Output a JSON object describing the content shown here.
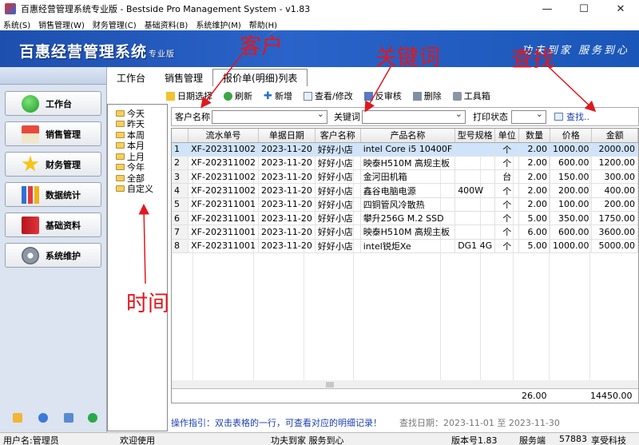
{
  "window": {
    "title": "百惠经营管理系统专业版 - Bestside Pro Management System - v1.83",
    "controls": [
      "—",
      "☐",
      "✕"
    ]
  },
  "menu": [
    "系统(S)",
    "销售管理(W)",
    "财务管理(C)",
    "基础资料(B)",
    "系统维护(M)",
    "帮助(H)"
  ],
  "banner": {
    "brand": "百惠经营管理系统",
    "edition": "专业版",
    "slogan": "功夫到家  服务到心"
  },
  "nav": [
    "工作台",
    "销售管理",
    "财务管理",
    "数据统计",
    "基础资料",
    "系统维护"
  ],
  "tabs": [
    "工作台",
    "销售管理",
    "报价单(明细)列表"
  ],
  "toolbar": [
    "日期选择",
    "刷新",
    "新增",
    "查看/修改",
    "反审核",
    "删除",
    "工具箱"
  ],
  "tree": [
    "今天",
    "昨天",
    "本周",
    "本月",
    "上月",
    "今年",
    "全部",
    "自定义"
  ],
  "search": {
    "customer_label": "客户名称",
    "keyword_label": "关键词",
    "print_label": "打印状态",
    "find_label": "查找.."
  },
  "grid": {
    "columns": [
      "",
      "流水单号",
      "单据日期",
      "客户名称",
      "产品名称",
      "型号规格",
      "单位",
      "数量",
      "价格",
      "金额"
    ],
    "rows": [
      [
        "1",
        "XF-202311002",
        "2023-11-20",
        "好好小店",
        "intel Core i5 10400F",
        "",
        "个",
        "2.00",
        "1000.00",
        "2000.00"
      ],
      [
        "2",
        "XF-202311002",
        "2023-11-20",
        "好好小店",
        "映泰H510M 高规主板",
        "",
        "个",
        "2.00",
        "600.00",
        "1200.00"
      ],
      [
        "3",
        "XF-202311002",
        "2023-11-20",
        "好好小店",
        "金河田机箱",
        "",
        "台",
        "2.00",
        "150.00",
        "300.00"
      ],
      [
        "4",
        "XF-202311002",
        "2023-11-20",
        "好好小店",
        "鑫谷电脑电源",
        "400W",
        "个",
        "2.00",
        "200.00",
        "400.00"
      ],
      [
        "5",
        "XF-202311001",
        "2023-11-20",
        "好好小店",
        "四铜管风冷散热",
        "",
        "个",
        "2.00",
        "100.00",
        "200.00"
      ],
      [
        "6",
        "XF-202311001",
        "2023-11-20",
        "好好小店",
        "攀升256G M.2 SSD",
        "",
        "个",
        "5.00",
        "350.00",
        "1750.00"
      ],
      [
        "7",
        "XF-202311001",
        "2023-11-20",
        "好好小店",
        "映泰H510M 高规主板",
        "",
        "个",
        "6.00",
        "600.00",
        "3600.00"
      ],
      [
        "8",
        "XF-202311001",
        "2023-11-20",
        "好好小店",
        "intel锐炬Xe",
        "DG1 4G",
        "个",
        "5.00",
        "1000.00",
        "5000.00"
      ]
    ],
    "total_qty": "26.00",
    "total_amount": "14450.00"
  },
  "hint": "操作指引：双击表格的一行，可查看对应的明细记录！",
  "query_date": "查找日期：2023-11-01 至 2023-11-30",
  "status": {
    "user": "用户名:管理员",
    "welcome": "欢迎使用",
    "motto": "功夫到家 服务到心",
    "version": "版本号1.83",
    "server": "服务端",
    "port": "57883",
    "company": "享受科技"
  },
  "annotations": {
    "customer": "客户",
    "keyword": "关键词",
    "find": "查找",
    "time": "时间"
  },
  "colors": {
    "banner": "#1d4fae",
    "annotation": "#e0181e",
    "selected_row": "#cfe4fb",
    "hint": "#1a3fb0"
  }
}
